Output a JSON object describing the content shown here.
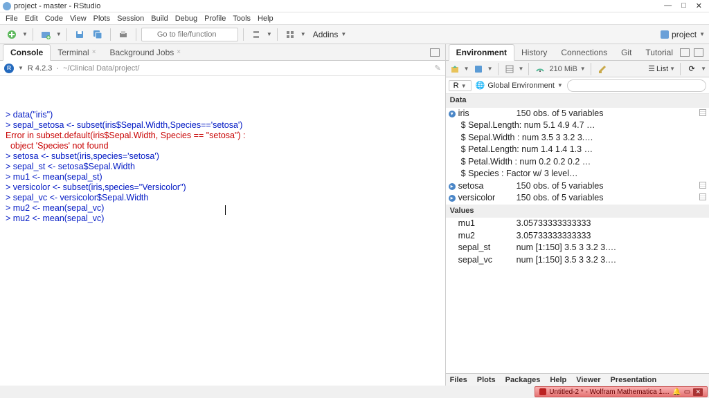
{
  "window": {
    "title": "project - master - RStudio"
  },
  "menu": [
    "File",
    "Edit",
    "Code",
    "View",
    "Plots",
    "Session",
    "Build",
    "Debug",
    "Profile",
    "Tools",
    "Help"
  ],
  "toolbar": {
    "goto_placeholder": "Go to file/function",
    "addins_label": "Addins",
    "project_label": "project"
  },
  "left": {
    "tabs": {
      "console": "Console",
      "terminal": "Terminal",
      "bg": "Background Jobs"
    },
    "r_version": "R 4.2.3",
    "path": "~/Clinical Data/project/",
    "console_lines": [
      {
        "p": "> ",
        "t": "data(\"iris\")"
      },
      {
        "p": "> ",
        "t": "sepal_setosa <- subset(iris$Sepal.Width,Species=='setosa')"
      },
      {
        "err": true,
        "t": "Error in subset.default(iris$Sepal.Width, Species == \"setosa\") : "
      },
      {
        "err": true,
        "t": "  object 'Species' not found"
      },
      {
        "p": "> ",
        "t": "setosa <- subset(iris,species='setosa')"
      },
      {
        "p": "> ",
        "t": "sepal_st <- setosa$Sepal.Width"
      },
      {
        "p": "> ",
        "t": "mu1 <- mean(sepal_st)"
      },
      {
        "p": "> ",
        "t": "versicolor <- subset(iris,species=\"Versicolor\")"
      },
      {
        "p": "> ",
        "t": "sepal_vc <- versicolor$Sepal.Width"
      },
      {
        "p": "> ",
        "t": "mu2 <- mean(sepal_vc)"
      },
      {
        "p": "> ",
        "t": "mu2 <- mean(sepal_vc)",
        "caret_at": 20
      }
    ]
  },
  "right": {
    "tabs": {
      "env": "Environment",
      "hist": "History",
      "conn": "Connections",
      "git": "Git",
      "tut": "Tutorial"
    },
    "mem": "210 MiB",
    "list_label": "List",
    "scope_r": "R",
    "scope_label": "Global Environment",
    "sections": {
      "data": "Data",
      "values": "Values"
    },
    "data_rows": [
      {
        "exp": true,
        "name": "iris",
        "desc": "150 obs. of  5 variables",
        "tbl": true
      },
      {
        "sub": true,
        "text": "$ Sepal.Length: num  5.1 4.9 4.7 …"
      },
      {
        "sub": true,
        "text": "$ Sepal.Width : num  3.5 3 3.2 3.…"
      },
      {
        "sub": true,
        "text": "$ Petal.Length: num  1.4 1.4 1.3 …"
      },
      {
        "sub": true,
        "text": "$ Petal.Width : num  0.2 0.2 0.2 …"
      },
      {
        "sub": true,
        "text": "$ Species     : Factor w/ 3 level…"
      },
      {
        "exp": false,
        "name": "setosa",
        "desc": "150 obs. of  5 variables",
        "tbl": true
      },
      {
        "exp": false,
        "name": "versicolor",
        "desc": "150 obs. of  5 variables",
        "tbl": true
      }
    ],
    "value_rows": [
      {
        "name": "mu1",
        "val": "3.05733333333333"
      },
      {
        "name": "mu2",
        "val": "3.05733333333333"
      },
      {
        "name": "sepal_st",
        "val": "num [1:150] 3.5 3 3.2 3.…"
      },
      {
        "name": "sepal_vc",
        "val": "num [1:150] 3.5 3 3.2 3.…"
      }
    ],
    "bottom_tabs": [
      "Files",
      "Plots",
      "Packages",
      "Help",
      "Viewer",
      "Presentation"
    ]
  },
  "taskbar": {
    "item": "Untitled-2 * - Wolfram Mathematica 1…"
  }
}
